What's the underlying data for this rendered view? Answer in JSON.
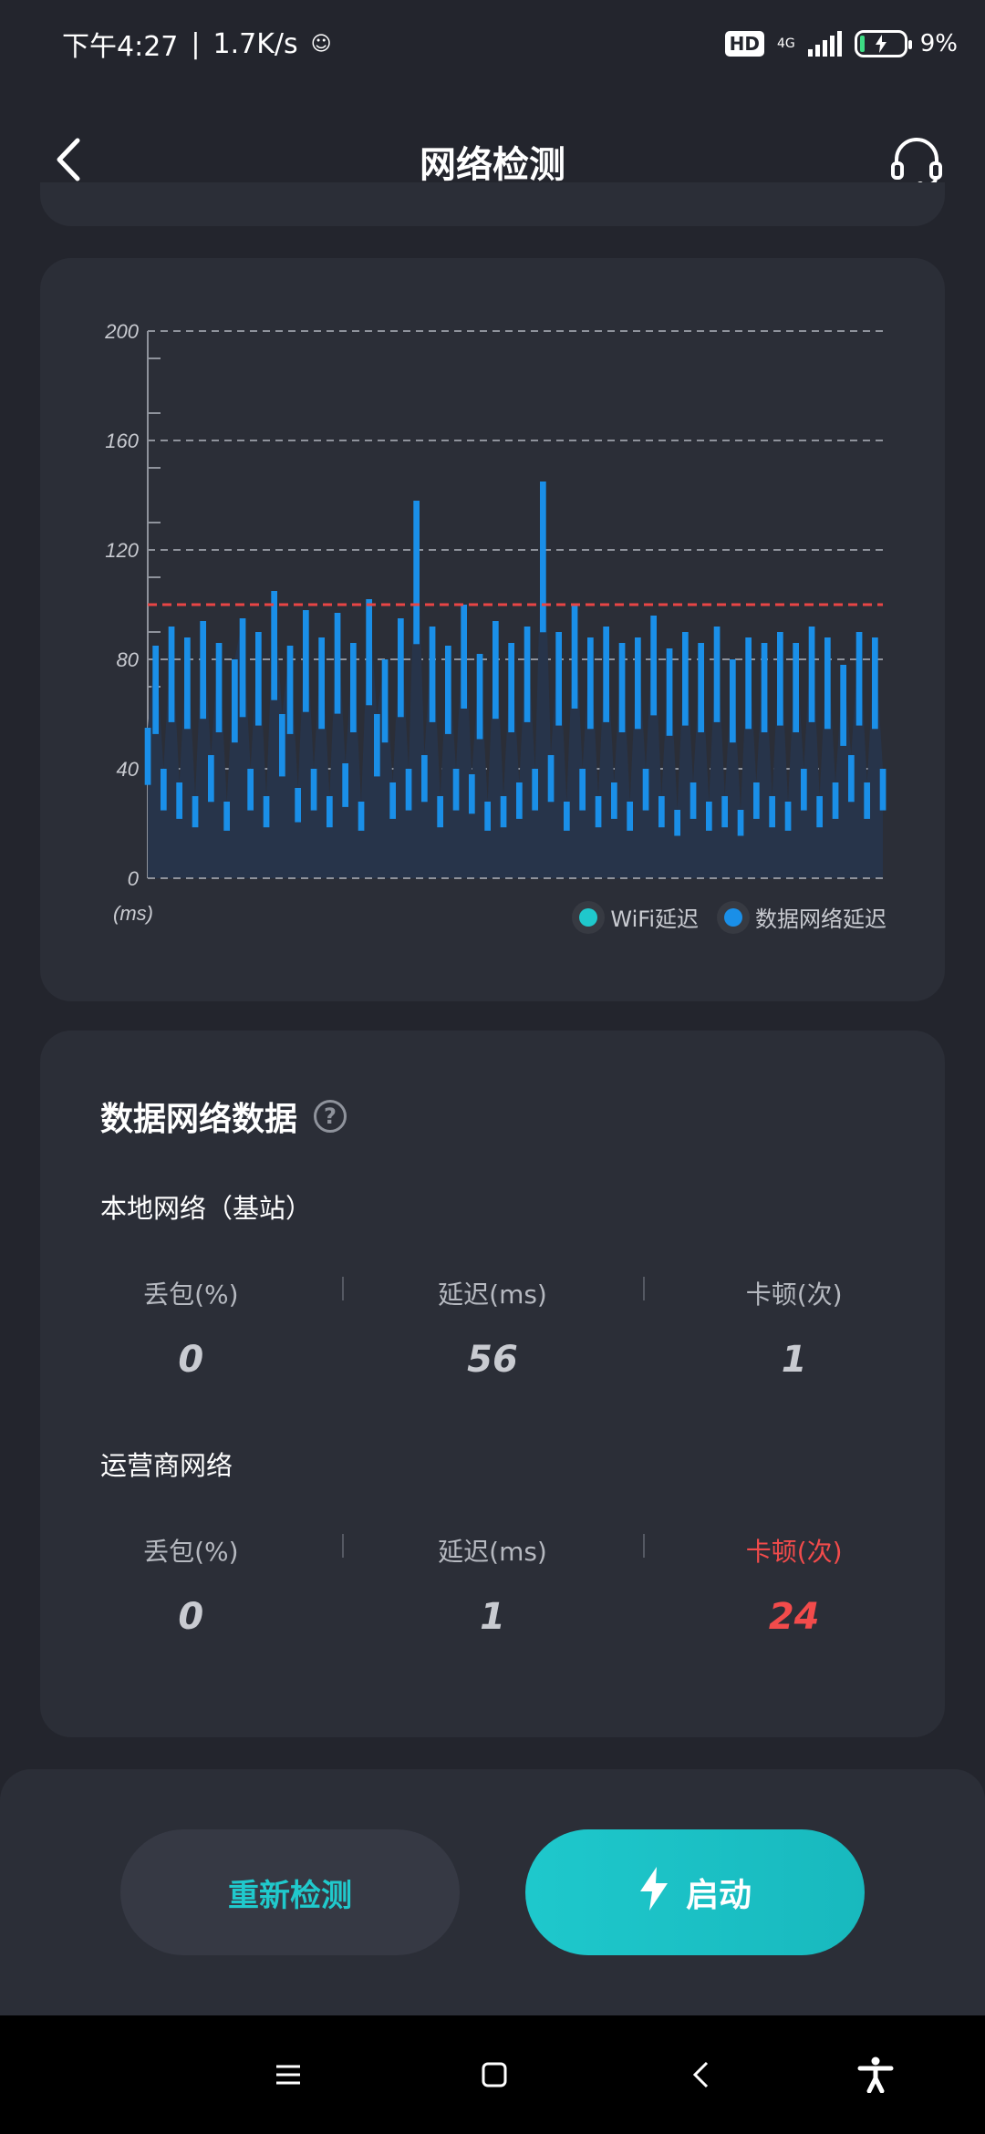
{
  "status_bar": {
    "time": "下午4:27",
    "speed": "1.7K/s",
    "network_type": "4G",
    "battery_percent": "9%",
    "hd_label": "HD"
  },
  "header": {
    "title": "网络检测",
    "back_icon": "chevron-left-icon",
    "support_icon": "headset-icon"
  },
  "chart_data": {
    "type": "area",
    "y_ticks": [
      "200",
      "160",
      "120",
      "80",
      "40",
      "0"
    ],
    "ylim": [
      0,
      200
    ],
    "unit_label": "(ms)",
    "threshold": 100,
    "threshold_color": "#e84545",
    "grid": true,
    "legend": [
      {
        "name": "WiFi延迟",
        "color": "#1fc8cc"
      },
      {
        "name": "数据网络延迟",
        "color": "#1a8fe8"
      }
    ],
    "legend_position": "bottom-right",
    "series": [
      {
        "name": "数据网络延迟",
        "color": "#1a8fe8",
        "values": [
          55,
          85,
          40,
          92,
          35,
          88,
          30,
          94,
          45,
          86,
          28,
          80,
          95,
          40,
          90,
          30,
          105,
          60,
          85,
          33,
          98,
          40,
          88,
          30,
          97,
          42,
          86,
          28,
          102,
          60,
          80,
          35,
          95,
          40,
          138,
          45,
          92,
          30,
          85,
          40,
          100,
          38,
          82,
          28,
          94,
          30,
          86,
          35,
          92,
          40,
          145,
          45,
          90,
          28,
          100,
          40,
          88,
          30,
          92,
          35,
          86,
          28,
          88,
          40,
          96,
          30,
          84,
          25,
          90,
          35,
          86,
          28,
          92,
          30,
          80,
          25,
          88,
          35,
          86,
          30,
          90,
          28,
          86,
          40,
          92,
          30,
          88,
          35,
          78,
          45,
          90,
          35,
          88,
          40
        ]
      }
    ]
  },
  "stats": {
    "section_title": "数据网络数据",
    "help_icon": "question-circle-icon",
    "local": {
      "title": "本地网络（基站）",
      "loss_label": "丢包(%)",
      "loss_value": "0",
      "latency_label": "延迟(ms)",
      "latency_value": "56",
      "stutter_label": "卡顿(次)",
      "stutter_value": "1"
    },
    "carrier": {
      "title": "运营商网络",
      "loss_label": "丢包(%)",
      "loss_value": "0",
      "latency_label": "延迟(ms)",
      "latency_value": "1",
      "stutter_label": "卡顿(次)",
      "stutter_value": "24"
    }
  },
  "actions": {
    "retest_label": "重新检测",
    "start_label": "启动",
    "start_icon": "lightning-icon"
  },
  "nav": {
    "menu_icon": "menu-icon",
    "home_icon": "square-home-icon",
    "back_icon": "back-triangle-icon",
    "accessibility_icon": "accessibility-icon"
  },
  "colors": {
    "background": "#23252d",
    "card": "#2b2e37",
    "accent": "#1ec8cc",
    "series_blue": "#1a8fe8",
    "alert_red": "#f24b4b"
  }
}
